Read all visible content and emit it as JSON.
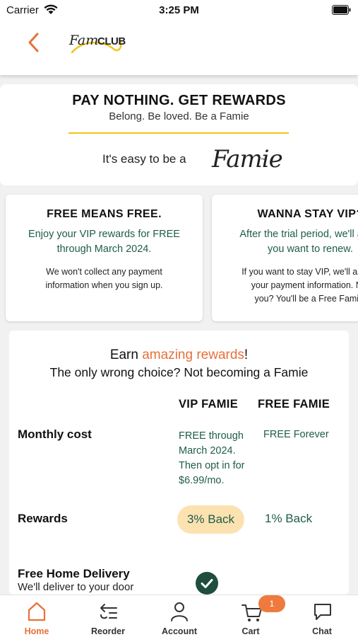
{
  "status_bar": {
    "carrier": "Carrier",
    "time": "3:25 PM"
  },
  "header": {
    "logo_script": "Fam",
    "logo_club": "CLUB"
  },
  "hero": {
    "title": "PAY NOTHING. GET REWARDS",
    "subtitle": "Belong. Be loved. Be a Famie",
    "easy_text": "It's easy to be a",
    "brand_word": "Famie",
    "tm": "™"
  },
  "promos": [
    {
      "title": "FREE MEANS FREE.",
      "body": "Enjoy your VIP rewards for FREE\nthrough March 2024.",
      "note": "We won't collect any payment\ninformation when you sign up."
    },
    {
      "title": "WANNA STAY VIP?",
      "body": "After the trial period, we'll ask if\nyou want to renew.",
      "note": "If you want to stay VIP, we'll ask for\nyour payment information. Not\nyou? You'll be a Free Famie."
    }
  ],
  "comparison": {
    "earn_prefix": "Earn ",
    "earn_accent": "amazing rewards",
    "earn_suffix": "!",
    "wrong_choice": "The only wrong choice? Not becoming a Famie",
    "col_vip": "VIP FAMIE",
    "col_free": "FREE FAMIE",
    "rows": {
      "monthly_label": "Monthly cost",
      "monthly_vip": "FREE through\nMarch 2024.\nThen opt in for\n$6.99/mo.",
      "monthly_free": "FREE Forever",
      "rewards_label": "Rewards",
      "rewards_vip": "3% Back",
      "rewards_free": "1% Back",
      "delivery_label": "Free Home Delivery",
      "delivery_sub": "We'll deliver to your door"
    }
  },
  "tabs": {
    "home": "Home",
    "reorder": "Reorder",
    "account": "Account",
    "cart": "Cart",
    "chat": "Chat",
    "cart_count": "1"
  },
  "colors": {
    "accent": "#e8703a",
    "green_text": "#1f5c4a",
    "yellow": "#f0c419",
    "pill": "#fbe2b0"
  },
  "icons": [
    "wifi-icon",
    "battery-icon",
    "back-chevron-icon",
    "home-icon",
    "reorder-icon",
    "account-icon",
    "cart-icon",
    "chat-icon",
    "check-icon"
  ]
}
